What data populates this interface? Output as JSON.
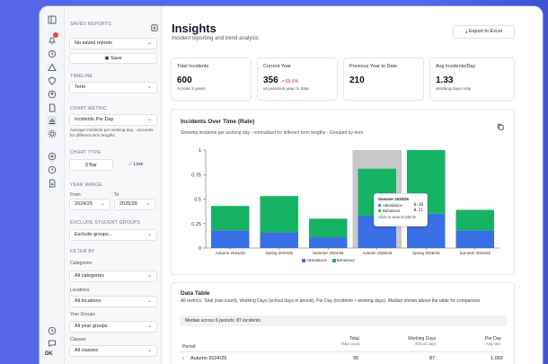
{
  "panel": {
    "saved_reports_label": "SAVED REPORTS",
    "saved_reports_value": "No saved reports",
    "save_label": "Save",
    "timeline_label": "TIMELINE",
    "timeline_value": "Term",
    "chart_metric_label": "CHART METRIC",
    "chart_metric_value": "Incidents Per Day",
    "chart_metric_help": "Average incidents per working day - accounts for different term lengths",
    "chart_type_label": "CHART TYPE",
    "chart_type_bar": "Bar",
    "chart_type_line": "Line",
    "year_range_label": "YEAR RANGE",
    "from_label": "From",
    "to_label": "To",
    "from_value": "2024/25",
    "to_value": "2025/26",
    "exclude_label": "EXCLUDE STUDENT GROUPS",
    "exclude_value": "Exclude groups...",
    "filter_label": "FILTER BY",
    "categories_label": "Categories",
    "categories_value": "All categories",
    "locations_label": "Locations",
    "locations_value": "All locations",
    "year_groups_label": "Year Groups",
    "year_groups_value": "All year groups",
    "classes_label": "Classes",
    "classes_value": "All classes"
  },
  "rail": {
    "user_initials": "DK"
  },
  "header": {
    "title": "Insights",
    "subtitle": "Incident reporting and trend analysis",
    "export_label": "Export to Excel"
  },
  "stats": [
    {
      "label": "Total Incidents",
      "value": "600",
      "sub": "Across 3 years",
      "change": ""
    },
    {
      "label": "Current Year",
      "value": "356",
      "sub": "vs previous year to date",
      "change": "69.5%"
    },
    {
      "label": "Previous Year to Date",
      "value": "210",
      "sub": "",
      "change": ""
    },
    {
      "label": "Avg Incidents/Day",
      "value": "1.33",
      "sub": "Working days only",
      "change": ""
    }
  ],
  "chart": {
    "title": "Incidents Over Time (Rate)",
    "subtitle": "Showing incidents per working day - normalised for different term lengths - Grouped by term",
    "tooltip": {
      "title": "Summer 2025/26",
      "attendance_label": "Attendance",
      "attendance_value": "0.18",
      "behaviour_label": "Behaviour",
      "behaviour_value": "0.21",
      "hint": "Click to view incidents"
    }
  },
  "chart_data": {
    "type": "bar",
    "stacked": true,
    "categories": [
      "Autumn 2024/25",
      "Spring 2024/25",
      "Summer 2024/25",
      "Autumn 2025/26",
      "Spring 2025/26",
      "Summer 2025/26"
    ],
    "series": [
      {
        "name": "Attendance",
        "values": [
          0.18,
          0.16,
          0.11,
          0.33,
          0.35,
          0.18
        ],
        "color": "#3b6fe6"
      },
      {
        "name": "Behaviour",
        "values": [
          0.25,
          0.37,
          0.19,
          0.48,
          0.65,
          0.21
        ],
        "color": "#16b364"
      }
    ],
    "highlight_category": "Autumn 2025/26",
    "ylim": [
      0,
      1
    ],
    "yticks": [
      "0",
      "0.25",
      "0.5",
      "0.75",
      "1"
    ],
    "grid": false,
    "legend": "bottom"
  },
  "table": {
    "title": "Data Table",
    "subtitle": "All metrics: Total (raw count), Working Days (school days in period), Per Day (incidents ÷ working days). Median shown above the table for comparison.",
    "median": "Median across 6 periods: 87 incidents",
    "col_period": "Period",
    "col_total": "Total",
    "col_total_sub": "Raw count",
    "col_days": "Working Days",
    "col_days_sub": "School days",
    "col_perday": "Per Day",
    "col_perday_sub": "Avg rate",
    "rows": [
      {
        "period": "Autumn 2024/25",
        "total": "95",
        "days": "87",
        "perday": "1.092"
      }
    ]
  },
  "colors": {
    "accent": "#5567e8",
    "attendance": "#3b6fe6",
    "behaviour": "#16b364",
    "negative": "#d12c2c"
  }
}
